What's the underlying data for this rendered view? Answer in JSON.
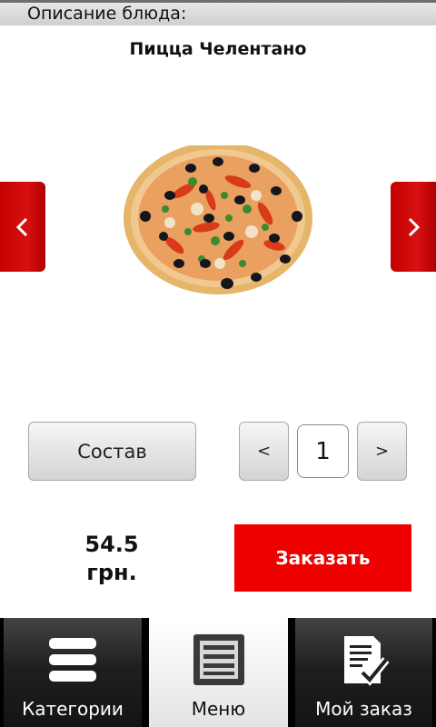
{
  "header": {
    "title": "Описание блюда:"
  },
  "dish": {
    "name": "Пицца Челентано",
    "image": "pizza-image",
    "price_value": "54.5",
    "price_currency": "грн."
  },
  "actions": {
    "composition_label": "Состав",
    "decrease_label": "<",
    "increase_label": ">",
    "quantity": "1",
    "order_label": "Заказать"
  },
  "nav": {
    "prev_icon": "chevron-left-icon",
    "next_icon": "chevron-right-icon"
  },
  "tabs": [
    {
      "label": "Категории",
      "icon": "hamburger-icon",
      "active": false
    },
    {
      "label": "Меню",
      "icon": "menu-list-icon",
      "active": true
    },
    {
      "label": "Мой заказ",
      "icon": "order-checklist-icon",
      "active": false
    }
  ],
  "colors": {
    "accent_red": "#ee0000",
    "arrow_red": "#c40000",
    "tab_dark": "#1f1f1f"
  }
}
